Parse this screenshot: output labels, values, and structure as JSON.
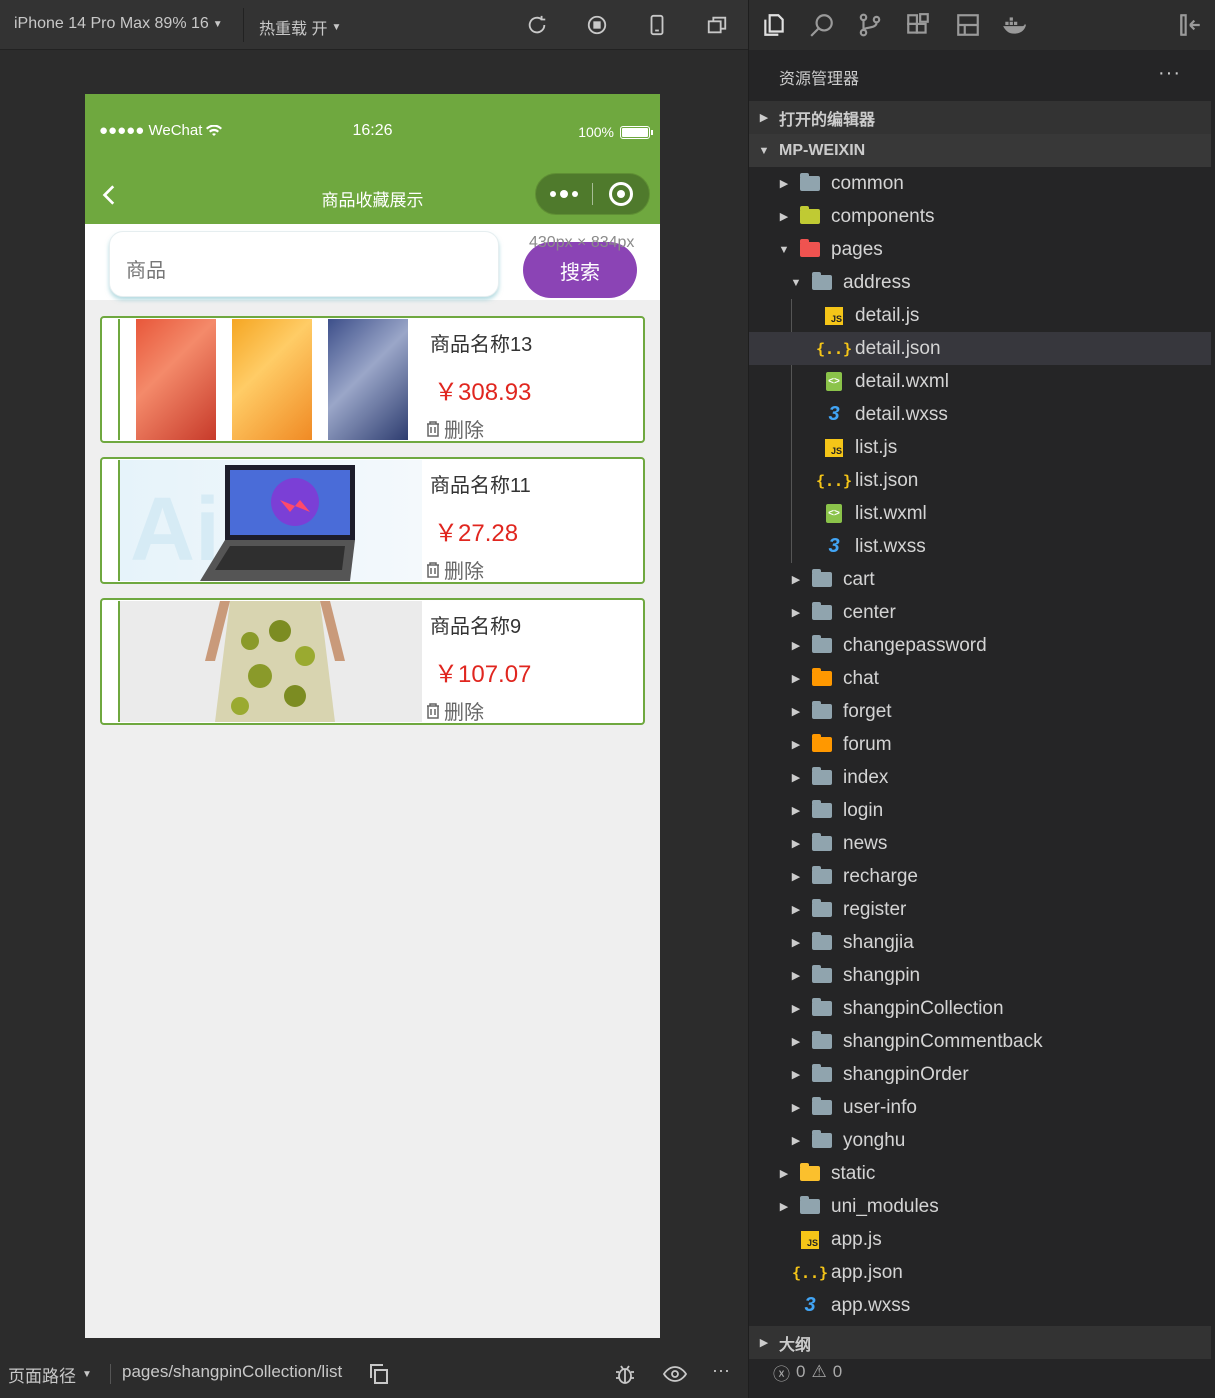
{
  "toolbar": {
    "device": "iPhone 14 Pro Max 89% 16",
    "hot_reload": "热重载 开"
  },
  "phone": {
    "carrier": "●●●●● WeChat",
    "time": "16:26",
    "battery": "100%",
    "nav_title": "商品收藏展示",
    "search_placeholder": "商品",
    "size_hint": "430px × 834px",
    "search_button": "搜索",
    "items": [
      {
        "name": "商品名称13",
        "price": "￥308.93",
        "delete": "删除"
      },
      {
        "name": "商品名称11",
        "price": "￥27.28",
        "delete": "删除"
      },
      {
        "name": "商品名称9",
        "price": "￥107.07",
        "delete": "删除"
      }
    ],
    "accent_color": "#6fa83f",
    "price_color": "#e0261f",
    "button_color": "#8b44b5"
  },
  "sim_bottom": {
    "path_label": "页面路径",
    "path": "pages/shangpinCollection/list"
  },
  "explorer": {
    "title": "资源管理器",
    "more": "···",
    "open_editors": "打开的编辑器",
    "project": "MP-WEIXIN",
    "outline": "大纲",
    "errors": "0",
    "warnings": "0",
    "tree": [
      {
        "label": "common",
        "depth": 1,
        "type": "folder",
        "color": "plain",
        "expanded": false
      },
      {
        "label": "components",
        "depth": 1,
        "type": "folder",
        "color": "green",
        "expanded": false
      },
      {
        "label": "pages",
        "depth": 1,
        "type": "folder",
        "color": "red",
        "expanded": true
      },
      {
        "label": "address",
        "depth": 2,
        "type": "folder-open",
        "color": "plain",
        "expanded": true
      },
      {
        "label": "detail.js",
        "depth": 3,
        "type": "js"
      },
      {
        "label": "detail.json",
        "depth": 3,
        "type": "json",
        "selected": true
      },
      {
        "label": "detail.wxml",
        "depth": 3,
        "type": "wxml"
      },
      {
        "label": "detail.wxss",
        "depth": 3,
        "type": "wxss"
      },
      {
        "label": "list.js",
        "depth": 3,
        "type": "js"
      },
      {
        "label": "list.json",
        "depth": 3,
        "type": "json"
      },
      {
        "label": "list.wxml",
        "depth": 3,
        "type": "wxml"
      },
      {
        "label": "list.wxss",
        "depth": 3,
        "type": "wxss"
      },
      {
        "label": "cart",
        "depth": 2,
        "type": "folder",
        "color": "plain"
      },
      {
        "label": "center",
        "depth": 2,
        "type": "folder",
        "color": "plain"
      },
      {
        "label": "changepassword",
        "depth": 2,
        "type": "folder",
        "color": "plain"
      },
      {
        "label": "chat",
        "depth": 2,
        "type": "folder",
        "color": "orange"
      },
      {
        "label": "forget",
        "depth": 2,
        "type": "folder",
        "color": "plain"
      },
      {
        "label": "forum",
        "depth": 2,
        "type": "folder",
        "color": "orange"
      },
      {
        "label": "index",
        "depth": 2,
        "type": "folder",
        "color": "plain"
      },
      {
        "label": "login",
        "depth": 2,
        "type": "folder",
        "color": "plain"
      },
      {
        "label": "news",
        "depth": 2,
        "type": "folder",
        "color": "plain"
      },
      {
        "label": "recharge",
        "depth": 2,
        "type": "folder",
        "color": "plain"
      },
      {
        "label": "register",
        "depth": 2,
        "type": "folder",
        "color": "plain"
      },
      {
        "label": "shangjia",
        "depth": 2,
        "type": "folder",
        "color": "plain"
      },
      {
        "label": "shangpin",
        "depth": 2,
        "type": "folder",
        "color": "plain"
      },
      {
        "label": "shangpinCollection",
        "depth": 2,
        "type": "folder",
        "color": "plain"
      },
      {
        "label": "shangpinCommentback",
        "depth": 2,
        "type": "folder",
        "color": "plain"
      },
      {
        "label": "shangpinOrder",
        "depth": 2,
        "type": "folder",
        "color": "plain"
      },
      {
        "label": "user-info",
        "depth": 2,
        "type": "folder",
        "color": "plain"
      },
      {
        "label": "yonghu",
        "depth": 2,
        "type": "folder",
        "color": "plain"
      },
      {
        "label": "static",
        "depth": 1,
        "type": "folder",
        "color": "yellow"
      },
      {
        "label": "uni_modules",
        "depth": 1,
        "type": "folder",
        "color": "plain"
      },
      {
        "label": "app.js",
        "depth": 1,
        "type": "js"
      },
      {
        "label": "app.json",
        "depth": 1,
        "type": "json"
      },
      {
        "label": "app.wxss",
        "depth": 1,
        "type": "wxss"
      }
    ]
  }
}
